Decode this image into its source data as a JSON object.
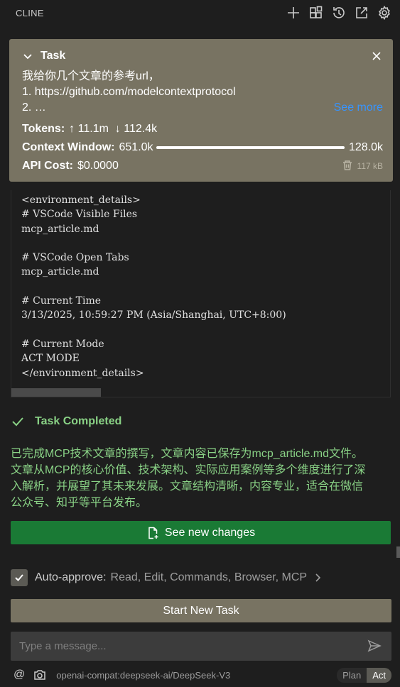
{
  "header": {
    "title": "CLINE"
  },
  "task": {
    "label": "Task",
    "lines": [
      "我给你几个文章的参考url，",
      "1. https://github.com/modelcontextprotocol",
      "2. …"
    ],
    "see_more": "See more",
    "tokens_label": "Tokens:",
    "tokens_up": "11.1m",
    "tokens_down": "112.4k",
    "context_label": "Context Window:",
    "context_used": "651.0k",
    "context_max": "128.0k",
    "api_label": "API Cost:",
    "api_value": "$0.0000",
    "size": "117 kB"
  },
  "env": {
    "lines": [
      "<environment_details>",
      "# VSCode Visible Files",
      "mcp_article.md",
      "",
      "# VSCode Open Tabs",
      "mcp_article.md",
      "",
      "# Current Time",
      "3/13/2025, 10:59:27 PM (Asia/Shanghai, UTC+8:00)",
      "",
      "# Current Mode",
      "ACT MODE",
      "</environment_details>"
    ]
  },
  "completion": {
    "title": "Task Completed",
    "lines": [
      "已完成MCP技术文章的撰写，文章内容已保存为mcp_article.md文件。",
      "文章从MCP的核心价值、技术架构、实际应用案例等多个维度进行了深",
      "入解析，并展望了其未来发展。文章结构清晰，内容专业，适合在微信",
      "公众号、知乎等平台发布。"
    ],
    "see_changes": "See new changes"
  },
  "auto_approve": {
    "label": "Auto-approve:",
    "value": "Read, Edit, Commands, Browser, MCP"
  },
  "start_new_task": "Start New Task",
  "message": {
    "placeholder": "Type a message..."
  },
  "footer": {
    "at": "@",
    "model": "openai-compat:deepseek-ai/DeepSeek-V3",
    "plan": "Plan",
    "act": "Act"
  }
}
